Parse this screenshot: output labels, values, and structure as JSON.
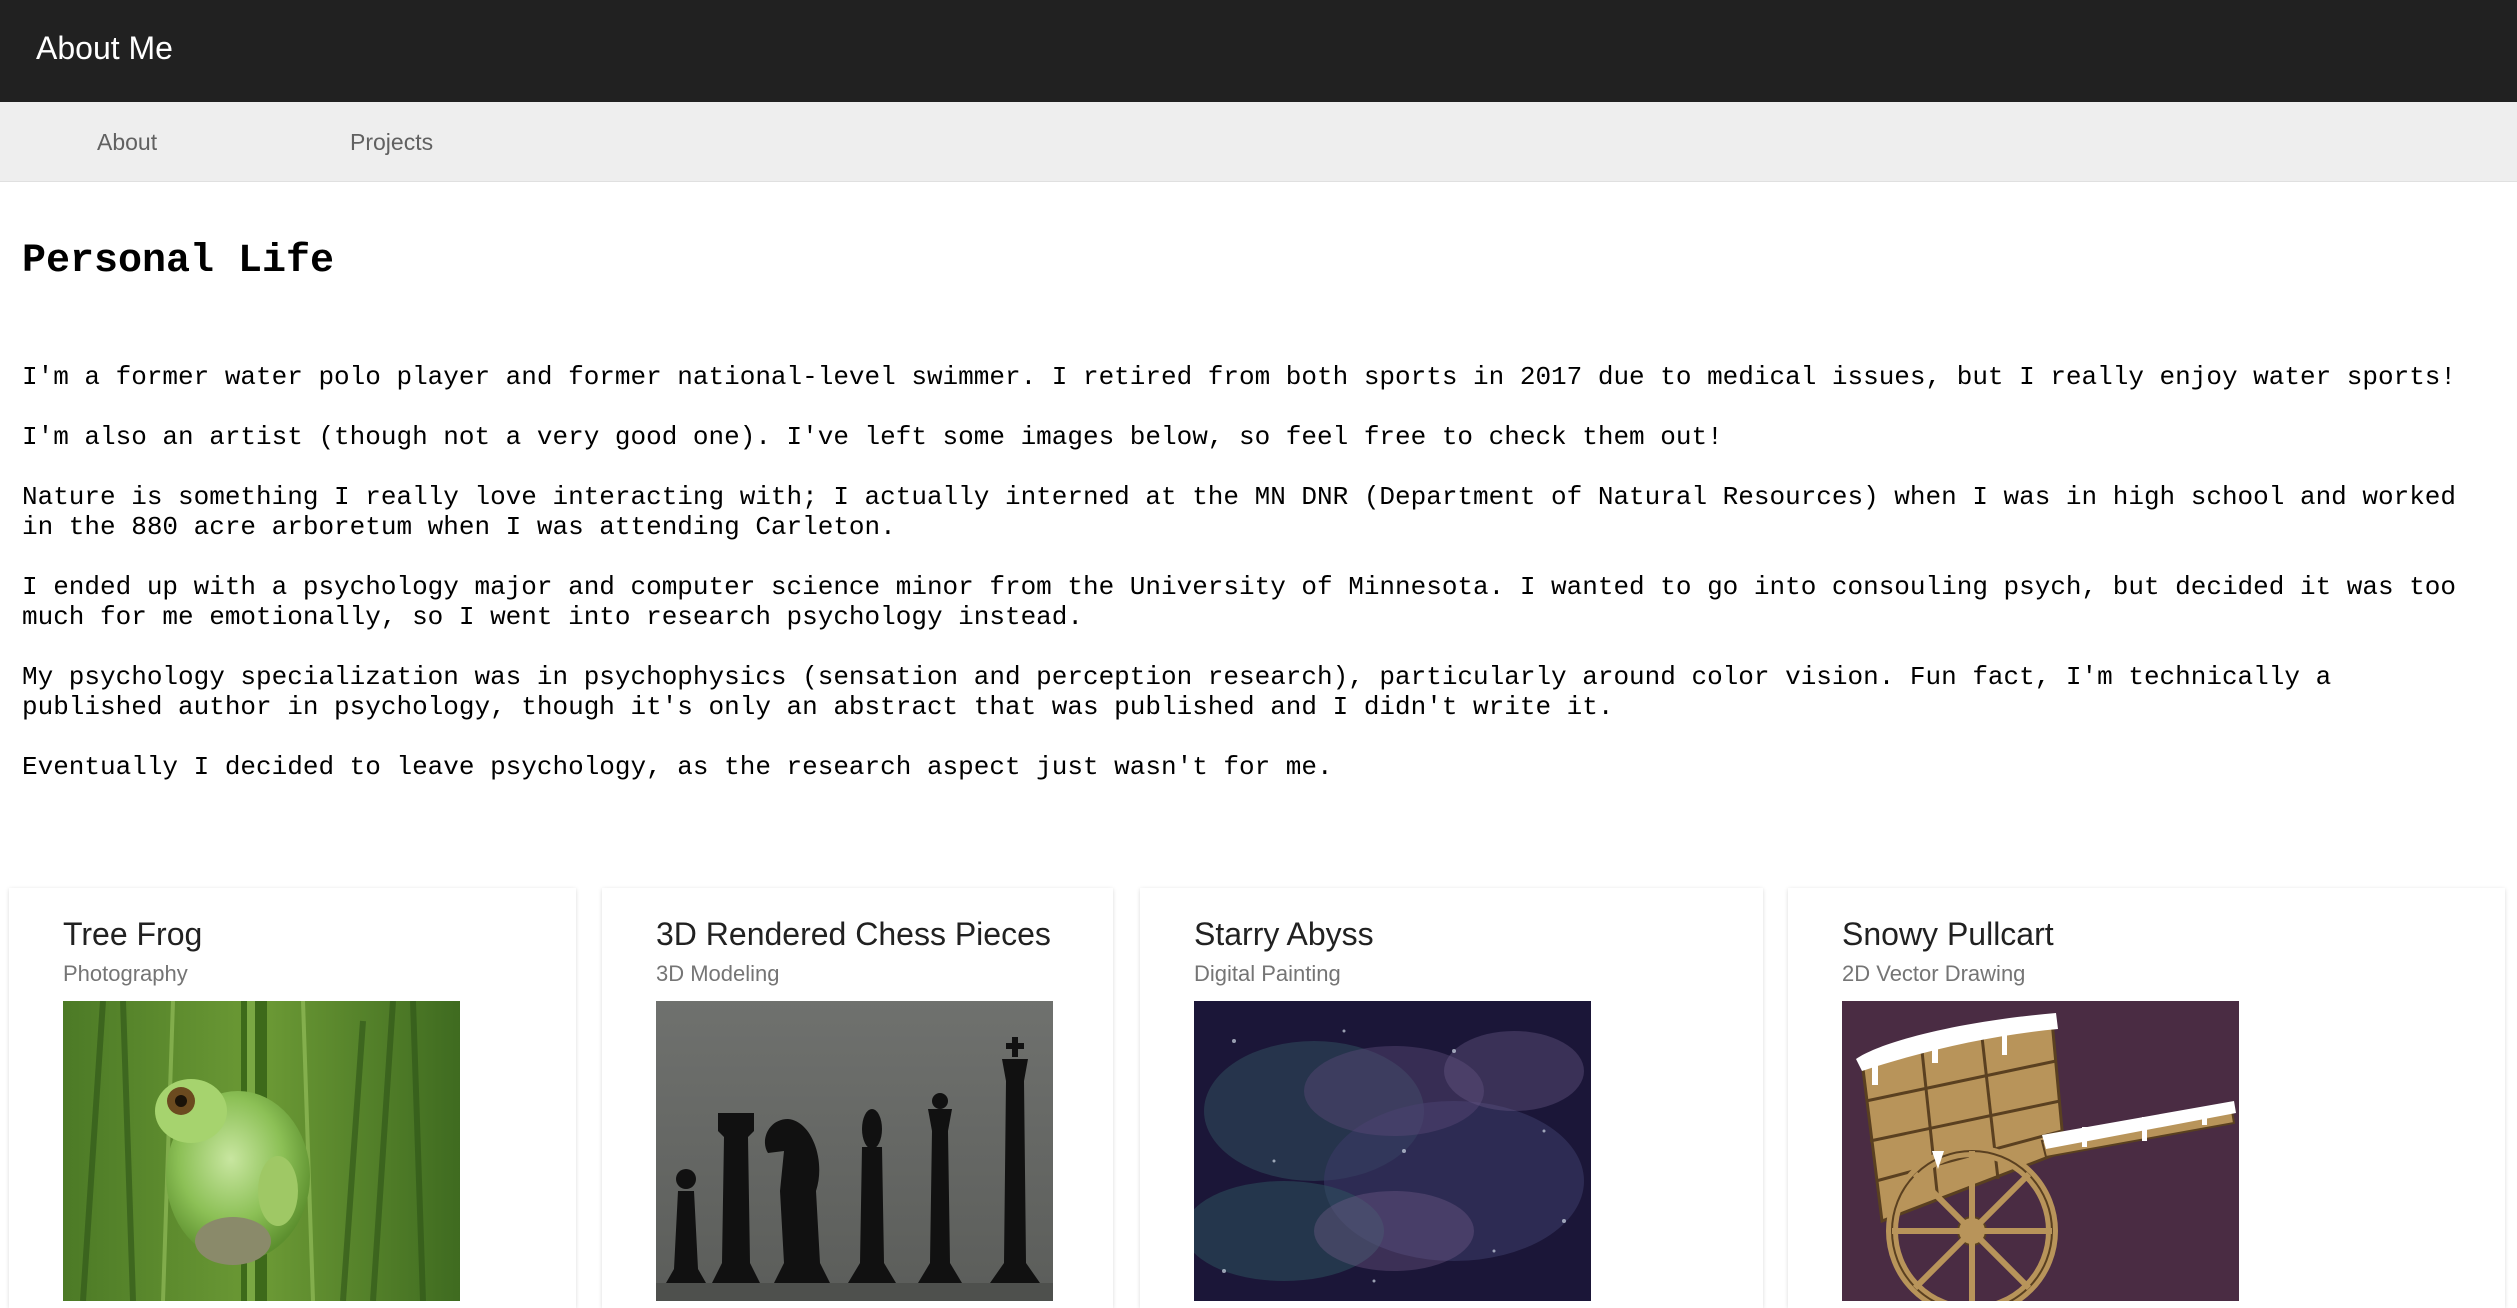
{
  "app": {
    "title": "About Me"
  },
  "nav": {
    "tabs": [
      {
        "label": "About"
      },
      {
        "label": "Projects"
      }
    ]
  },
  "main": {
    "heading": "Personal Life",
    "paragraphs": [
      "I'm a former water polo player and former national-level swimmer. I retired from both sports in 2017 due to medical issues, but I really enjoy water sports!",
      "I'm also an artist (though not a very good one). I've left some images below, so feel free to check them out!",
      "Nature is something I really love interacting with; I actually interned at the MN DNR (Department of Natural Resources) when I was in high school and worked in the 880 acre arboretum when I was attending Carleton.",
      "I ended up with a psychology major and computer science minor from the University of Minnesota. I wanted to go into consouling psych, but decided it was too much for me emotionally, so I went into research psychology instead.",
      "My psychology specialization was in psychophysics (sensation and perception research), particularly around color vision. Fun fact, I'm technically a published author in psychology, though it's only an abstract that was published and I didn't write it.",
      "Eventually I decided to leave psychology, as the research aspect just wasn't for me."
    ]
  },
  "gallery": {
    "cards": [
      {
        "title": "Tree Frog",
        "subtitle": "Photography",
        "image": "tree-frog-photo"
      },
      {
        "title": "3D Rendered Chess Pieces",
        "subtitle": "3D Modeling",
        "image": "chess-pieces-render"
      },
      {
        "title": "Starry Abyss",
        "subtitle": "Digital Painting",
        "image": "starry-abyss-painting"
      },
      {
        "title": "Snowy Pullcart",
        "subtitle": "2D Vector Drawing",
        "image": "snowy-pullcart-drawing"
      }
    ]
  },
  "colors": {
    "appbar": "#212121",
    "tabbar": "#eeeeee",
    "card_title": "#212121",
    "card_subtitle": "#757575"
  }
}
